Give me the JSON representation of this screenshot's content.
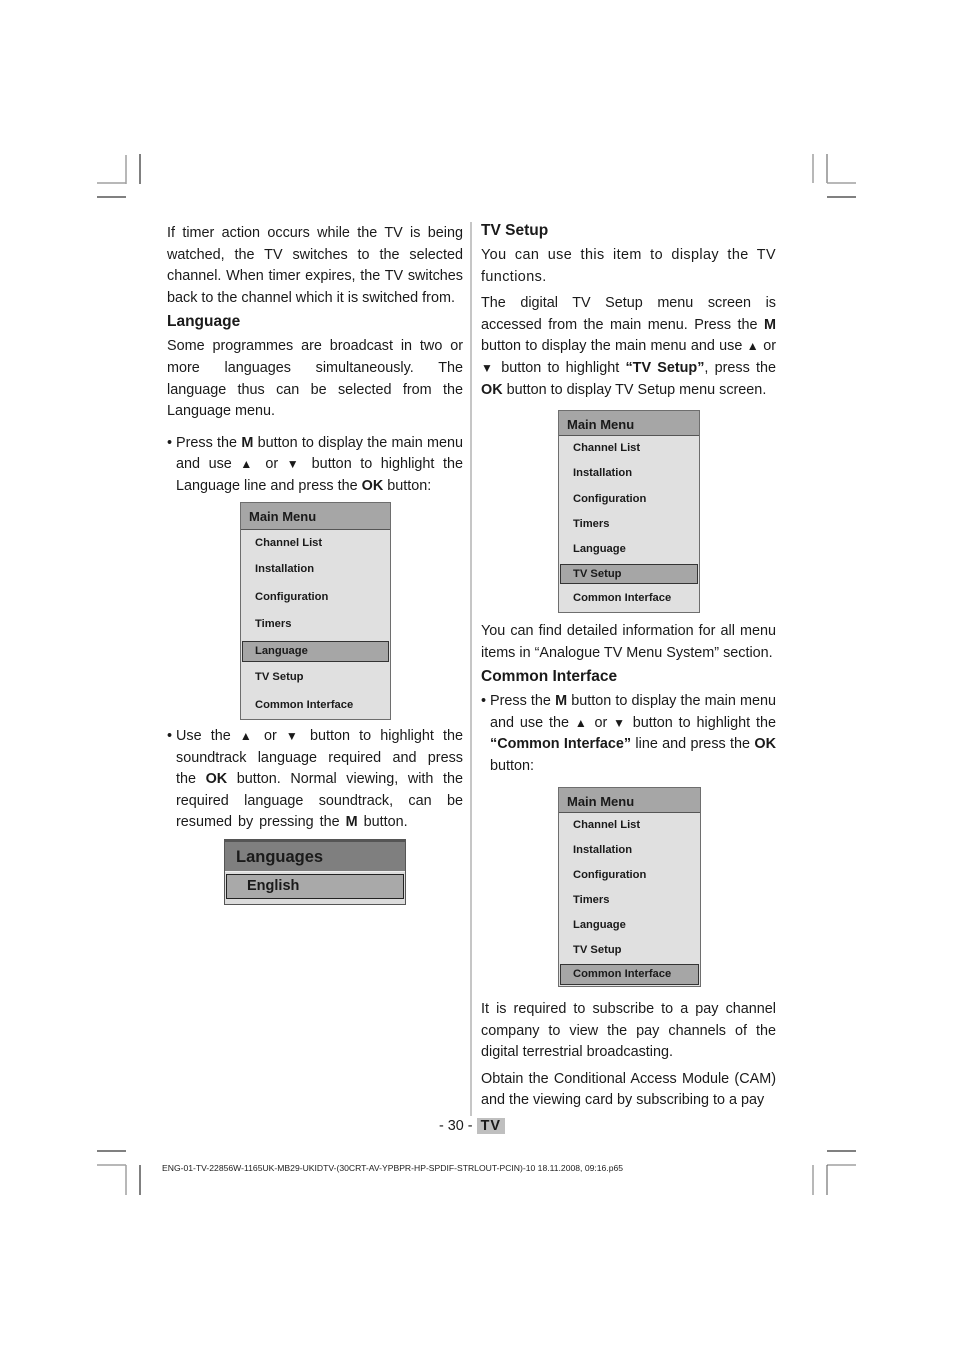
{
  "left_column": {
    "intro": "If timer action occurs while the TV is being watched, the TV switches to the selected channel. When timer expires, the TV switches back to the channel which it is switched from.",
    "language_heading": "Language",
    "language_para": "Some programmes are broadcast in two or more languages simultaneously. The language thus can be selected from the Language menu.",
    "bullet1": {
      "prefix": "Press the ",
      "key_m": "M",
      "mid": " button to display the main menu and use ",
      "up": "▲",
      "or": " or ",
      "down": "▼",
      "rest": " button to highlight the Language line and press the ",
      "key_ok": "OK",
      "suffix": " button:"
    },
    "bullet2": {
      "prefix": "Use the ",
      "up": "▲",
      "or": " or ",
      "down": "▼",
      "mid": " button to highlight the soundtrack language required and press the ",
      "key_ok": "OK",
      "rest": " button. Normal viewing, with the required language soundtrack, can be resumed by pressing the ",
      "key_m": "M",
      "suffix": " button."
    },
    "menu1": {
      "title": "Main Menu",
      "items": [
        "Channel List",
        "Installation",
        "Configuration",
        "Timers",
        "Language",
        "TV Setup",
        "Common Interface"
      ],
      "selected": "Language"
    },
    "languages_box": {
      "title": "Languages",
      "selected_item": "English"
    }
  },
  "right_column": {
    "tvsetup_heading": "TV Setup",
    "tvsetup_para1": "You can use this item to display the TV functions.",
    "tvsetup_para2": {
      "prefix": "The digital TV Setup menu screen is accessed from the main menu. Press the ",
      "key_m": "M",
      "mid": " button to display the main menu and use ",
      "up": "▲",
      "or": " or ",
      "down": "▼",
      "mid2": " button to highlight ",
      "quoted": "“TV Setup”",
      "mid3": ", press the ",
      "key_ok": "OK",
      "suffix": " button to display TV Setup menu screen."
    },
    "menu2": {
      "title": "Main Menu",
      "items": [
        "Channel List",
        "Installation",
        "Configuration",
        "Timers",
        "Language",
        "TV Setup",
        "Common Interface"
      ],
      "selected": "TV Setup"
    },
    "info_para": "You can find detailed information for all menu items in “Analogue TV Menu System” section.",
    "ci_heading": "Common Interface",
    "ci_bullet": {
      "prefix": "Press the ",
      "key_m": "M",
      "mid": " button to display the main menu and use the ",
      "up": "▲",
      "or": " or ",
      "down": "▼",
      "mid2": " button to highlight the ",
      "quoted": "“Common Interface”",
      "mid3": " line and press the ",
      "key_ok": "OK",
      "suffix": " button:"
    },
    "menu3": {
      "title": "Main Menu",
      "items": [
        "Channel List",
        "Installation",
        "Configuration",
        "Timers",
        "Language",
        "TV Setup",
        "Common Interface"
      ],
      "selected": "Common Interface"
    },
    "pay_para": "It is required to subscribe to a pay channel company to view the pay channels of the digital terrestrial broadcasting.",
    "cam_para": "Obtain the Conditional Access Module (CAM) and the viewing card by subscribing to a pay"
  },
  "page_footer": {
    "page_number": "- 30 -",
    "section_tag": "TV",
    "file_info": "ENG-01-TV-22856W-1165UK-MB29-UKIDTV-(30CRT-AV-YPBPR-HP-SPDIF-STRLOUT-PCIN)-10\t18.11.2008, 09:16.p65"
  }
}
